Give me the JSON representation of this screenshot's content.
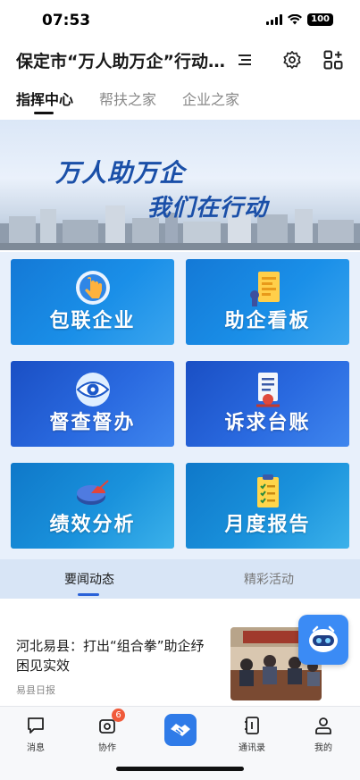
{
  "status": {
    "time": "07:53",
    "battery": "100"
  },
  "header": {
    "title": "保定市“万人助万企”行动…"
  },
  "tabs": [
    {
      "label": "指挥中心",
      "active": true
    },
    {
      "label": "帮扶之家",
      "active": false
    },
    {
      "label": "企业之家",
      "active": false
    }
  ],
  "banner": {
    "line1": "万人助万企",
    "line2": "我们在行动"
  },
  "grid": [
    {
      "label": "包联企业",
      "icon": "hand-pointer-icon"
    },
    {
      "label": "助企看板",
      "icon": "dashboard-icon"
    },
    {
      "label": "督查督办",
      "icon": "eye-icon"
    },
    {
      "label": "诉求台账",
      "icon": "ledger-icon"
    },
    {
      "label": "绩效分析",
      "icon": "pie-chart-icon"
    },
    {
      "label": "月度报告",
      "icon": "clipboard-icon"
    }
  ],
  "news_tabs": [
    {
      "label": "要闻动态",
      "active": true
    },
    {
      "label": "精彩活动",
      "active": false
    }
  ],
  "news": [
    {
      "title": "河北易县：打出“组合拳”助企纾困见实效",
      "source": "易县日报"
    }
  ],
  "bottom_nav": [
    {
      "label": "消息",
      "icon": "message-icon"
    },
    {
      "label": "协作",
      "icon": "collaborate-icon",
      "badge": "6"
    },
    {
      "label": "",
      "icon": "handshake-icon"
    },
    {
      "label": "通讯录",
      "icon": "contacts-icon"
    },
    {
      "label": "我的",
      "icon": "profile-icon"
    }
  ],
  "colors": {
    "accent": "#2f7be8",
    "card_blue": "#1a6fd6",
    "badge": "#f05a3a"
  }
}
